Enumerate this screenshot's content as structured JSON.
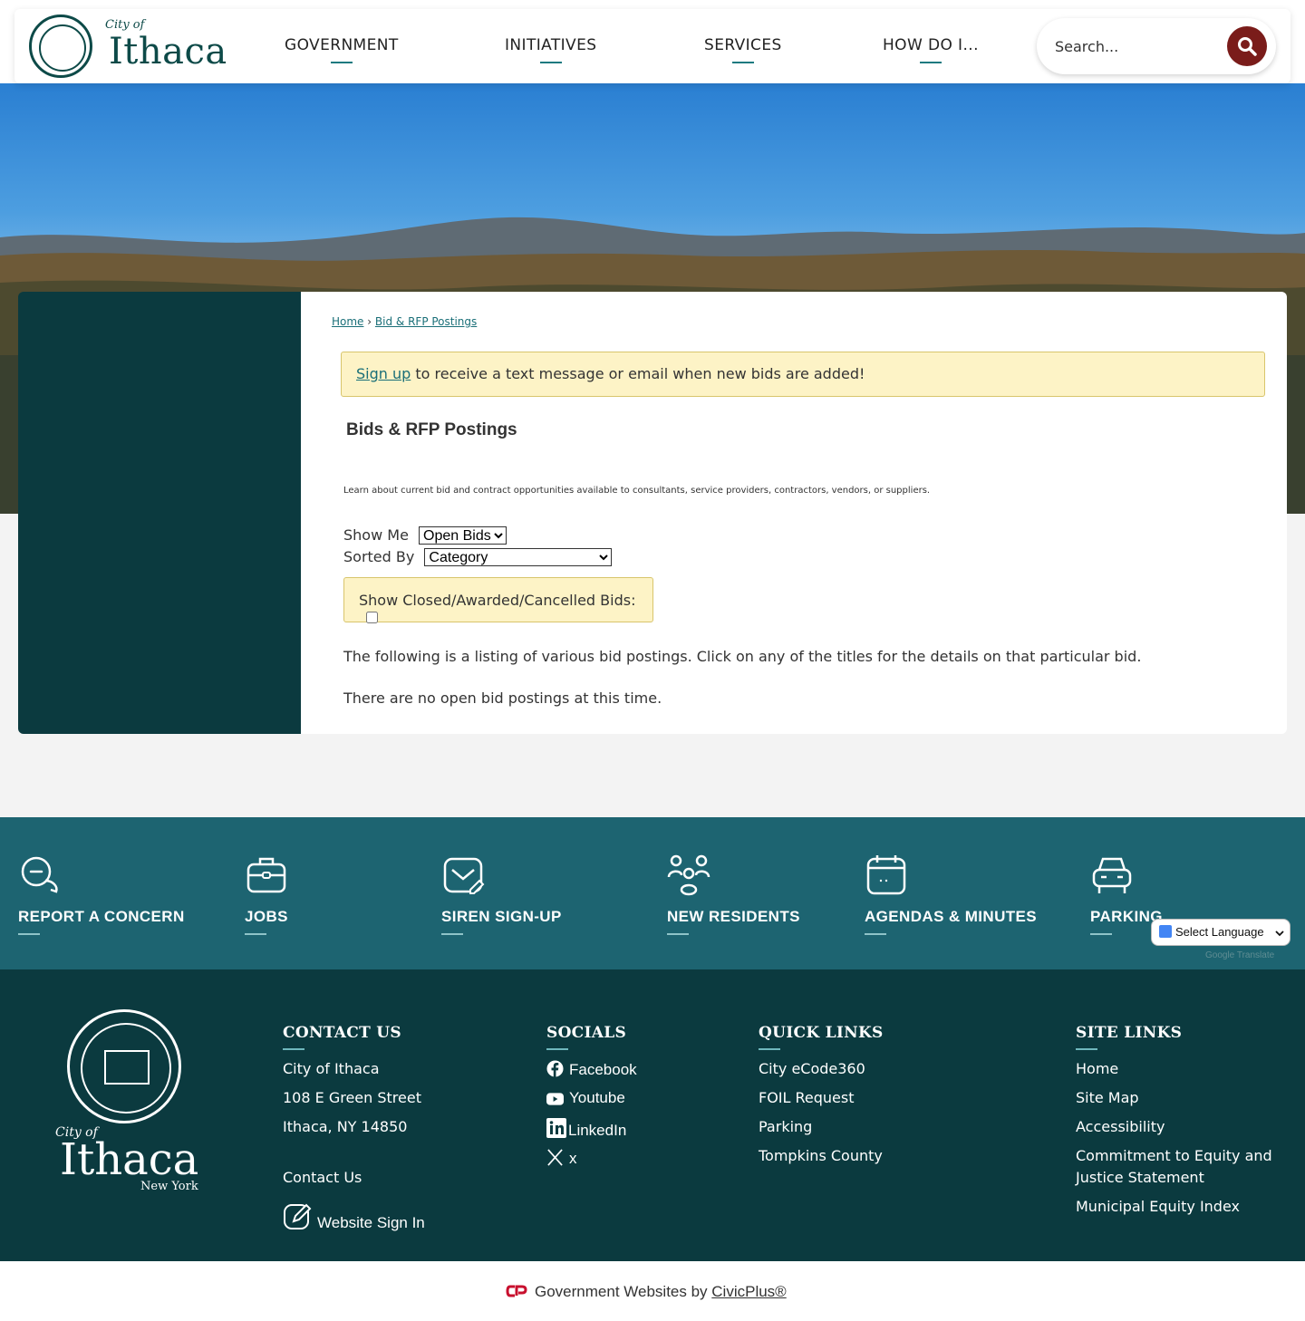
{
  "header": {
    "logo_city_of": "City of",
    "logo_name": "Ithaca",
    "nav": [
      "GOVERNMENT",
      "INITIATIVES",
      "SERVICES",
      "HOW DO I..."
    ],
    "search_placeholder": "Search..."
  },
  "breadcrumb": {
    "home": "Home",
    "sep": "›",
    "current": "Bid & RFP Postings"
  },
  "alert": {
    "link": "Sign up",
    "text": " to receive a text message or email when new bids are added!"
  },
  "page": {
    "title": "Bids & RFP Postings",
    "intro": "Learn about current bid and contract opportunities available to consultants, service providers, contractors, vendors, or suppliers.",
    "show_me_label": "Show Me",
    "show_me_value": "Open Bids",
    "sorted_by_label": "Sorted By",
    "sorted_by_value": "Category",
    "closed_label": "Show Closed/Awarded/Cancelled Bids:",
    "listing_text": "The following is a listing of various bid postings. Click on any of the titles for the details on that particular bid.",
    "empty_text": "There are no open bid postings at this time."
  },
  "quick_links": [
    {
      "label": "REPORT A CONCERN",
      "icon": "chat-bubbles-icon"
    },
    {
      "label": "JOBS",
      "icon": "briefcase-icon"
    },
    {
      "label": "SIREN SIGN-UP",
      "icon": "mail-edit-icon"
    },
    {
      "label": "NEW RESIDENTS",
      "icon": "people-group-icon"
    },
    {
      "label": "AGENDAS & MINUTES",
      "icon": "calendar-icon"
    },
    {
      "label": "PARKING",
      "icon": "car-icon"
    }
  ],
  "translate": {
    "label": "Select Language",
    "powered": "Google Translate"
  },
  "footer": {
    "logo_city_of": "City of",
    "logo_name": "Ithaca",
    "logo_state": "New York",
    "contact": {
      "heading": "CONTACT US",
      "line1": "City of Ithaca",
      "line2": "108 E Green Street",
      "line3": "Ithaca, NY 14850",
      "contact_link": "Contact Us",
      "sign_in": "Website Sign In"
    },
    "socials": {
      "heading": "SOCIALS",
      "items": [
        "Facebook",
        "Youtube",
        "LinkedIn",
        "x"
      ]
    },
    "quick_links": {
      "heading": "QUICK LINKS",
      "items": [
        "City eCode360",
        "FOIL Request",
        "Parking",
        "Tompkins County"
      ]
    },
    "site_links": {
      "heading": "SITE LINKS",
      "items": [
        "Home",
        "Site Map",
        "Accessibility",
        "Commitment to Equity and",
        "Justice Statement",
        "Municipal Equity Index"
      ]
    }
  },
  "bottom": {
    "text": "Government Websites by ",
    "link": "CivicPlus®"
  },
  "colors": {
    "primary": "#0b3a3f",
    "accent_bar": "#1d6471",
    "search_button": "#7a1c1a",
    "alert_bg": "#fdf3c6"
  }
}
